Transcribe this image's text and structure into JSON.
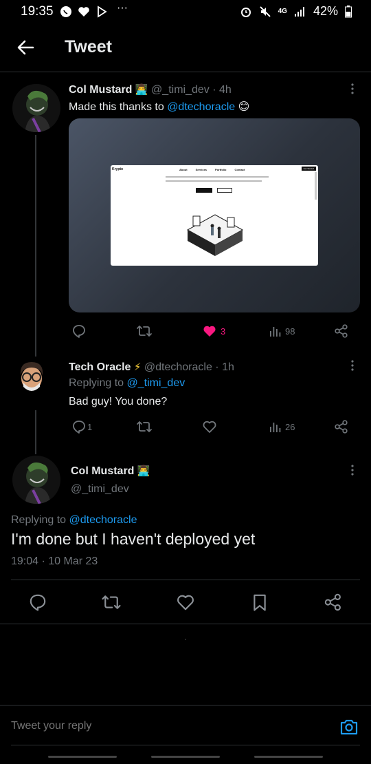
{
  "status_bar": {
    "time": "19:35",
    "overflow": "···",
    "network": "4G",
    "battery": "42%"
  },
  "header": {
    "title": "Tweet"
  },
  "tweet1": {
    "name": "Col Mustard",
    "emoji": "👨‍💻",
    "handle": "@_timi_dev",
    "time": "· 4h",
    "text_before": "Made this thanks to ",
    "mention": "@dtechoracle",
    "text_emoji": "😊",
    "preview": {
      "brand": "Krypto",
      "nav": [
        "About",
        "Services",
        "Portfolio",
        "Contact"
      ],
      "cta": "Get Started"
    },
    "likes": "3",
    "views": "98"
  },
  "tweet2": {
    "name": "Tech Oracle",
    "badge": "⚡",
    "handle": "@dtechoracle",
    "time": "· 1h",
    "replying_label": "Replying to ",
    "replying_to": "@_timi_dev",
    "text": "Bad guy! You done?",
    "replies": "1",
    "views": "26"
  },
  "main_tweet": {
    "name": "Col Mustard",
    "emoji": "👨‍💻",
    "handle": "@_timi_dev",
    "replying_label": "Replying to ",
    "replying_to": "@dtechoracle",
    "text": "I'm done but I haven't deployed yet",
    "timestamp": "19:04 · 10 Mar 23"
  },
  "reply_bar": {
    "placeholder": "Tweet your reply"
  },
  "colors": {
    "accent": "#1d9bf0",
    "like": "#f91880",
    "muted": "#71767b"
  },
  "icons": [
    "back-arrow-icon",
    "more-icon",
    "reply-icon",
    "retweet-icon",
    "like-icon",
    "views-icon",
    "share-icon",
    "bookmark-icon",
    "camera-icon"
  ]
}
